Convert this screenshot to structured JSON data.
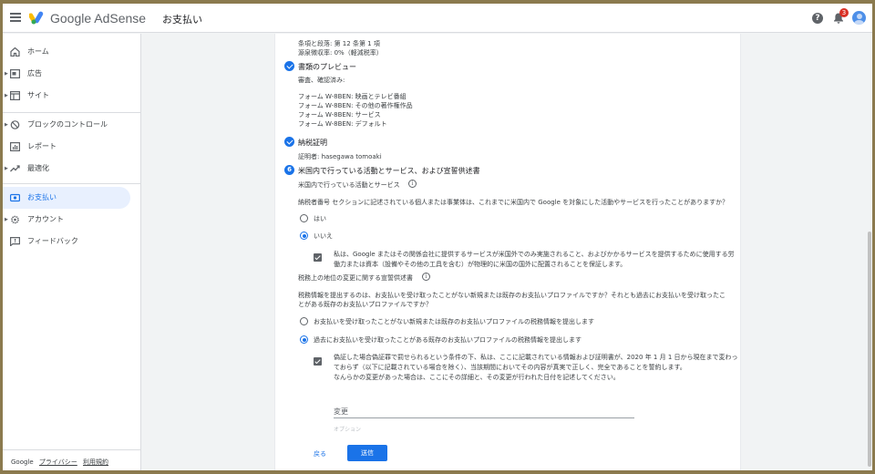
{
  "header": {
    "app_name": "Google AdSense",
    "page_title": "お支払い",
    "help_label": "?",
    "notification_count": "3"
  },
  "sidebar": {
    "items": [
      {
        "label": "ホーム",
        "icon": "home-icon",
        "expandable": false
      },
      {
        "label": "広告",
        "icon": "ads-icon",
        "expandable": true
      },
      {
        "label": "サイト",
        "icon": "sites-icon",
        "expandable": true
      },
      {
        "label": "ブロックのコントロール",
        "icon": "block-icon",
        "expandable": true
      },
      {
        "label": "レポート",
        "icon": "reports-icon",
        "expandable": false
      },
      {
        "label": "最適化",
        "icon": "optimize-icon",
        "expandable": true
      },
      {
        "label": "お支払い",
        "icon": "payments-icon",
        "expandable": false,
        "active": true
      },
      {
        "label": "アカウント",
        "icon": "account-icon",
        "expandable": true
      },
      {
        "label": "フィードバック",
        "icon": "feedback-icon",
        "expandable": false
      }
    ],
    "footer": {
      "brand": "Google",
      "privacy": "プライバシー",
      "terms": "利用規約"
    }
  },
  "main": {
    "top_lines": [
      "条項と段落: 第 12 条第 1 項",
      "源泉徴収率: 0%（軽減税率）"
    ],
    "doc_preview": {
      "title": "書類のプレビュー",
      "status": "審査、確認済み:",
      "forms": [
        "フォーム W-8BEN: 映画とテレビ番組",
        "フォーム W-8BEN: その他の著作権作品",
        "フォーム W-8BEN: サービス",
        "フォーム W-8BEN: デフォルト"
      ]
    },
    "tax_cert": {
      "title": "納税証明",
      "signer": "証明者: hasegawa tomoaki"
    },
    "step6": {
      "number": "6",
      "title": "米国内で行っている活動とサービス、および宣誓供述書",
      "subsection1": "米国内で行っている活動とサービス",
      "question1": "納税者番号 セクションに記述されている個人または事業体は、これまでに米国内で Google を対象にした活動やサービスを行ったことがありますか？",
      "option_yes": "はい",
      "option_no": "いいえ",
      "affidavit1_line1": "私は、Google またはその関係会社に提供するサービスが米国外でのみ実施されること、およびかかるサービスを提供するために使用する労",
      "affidavit1_line2": "働力または資本（設備やその他の工具を含む）が物理的に米国の国外に配置されることを保証します。",
      "subsection2": "税務上の地位の変更に関する宣誓供述書",
      "question2_line1": "税務情報を提出するのは、お支払いを受け取ったことがない新規または既存のお支払いプロファイルですか？それとも過去にお支払いを受け取ったこ",
      "question2_line2": "とがある既存のお支払いプロファイルですか？",
      "option_new": "お支払いを受け取ったことがない新規または既存のお支払いプロファイルの税務情報を提出します",
      "option_existing": "過去にお支払いを受け取ったことがある既存のお支払いプロファイルの税務情報を提出します",
      "affidavit2_line1": "偽証した場合偽証罪で罰せられるという条件の下、私は、ここに記載されている情報および証明書が、2020 年 1 月 1 日から現在まで変わっ",
      "affidavit2_line2": "ておらず（以下に記載されている場合を除く）、当該期間においてその内容が真実で正しく、完全であることを誓約します。",
      "affidavit2_line3": "なんらかの変更があった場合は、ここにその詳細と、その変更が行われた日付を記述してください。",
      "change_label": "変更",
      "change_placeholder": "オプション"
    },
    "buttons": {
      "back": "戻る",
      "submit": "送信"
    }
  },
  "colors": {
    "accent": "#1a73e8",
    "active_bg": "#e8f0fe",
    "frame": "#8b7a4e"
  }
}
